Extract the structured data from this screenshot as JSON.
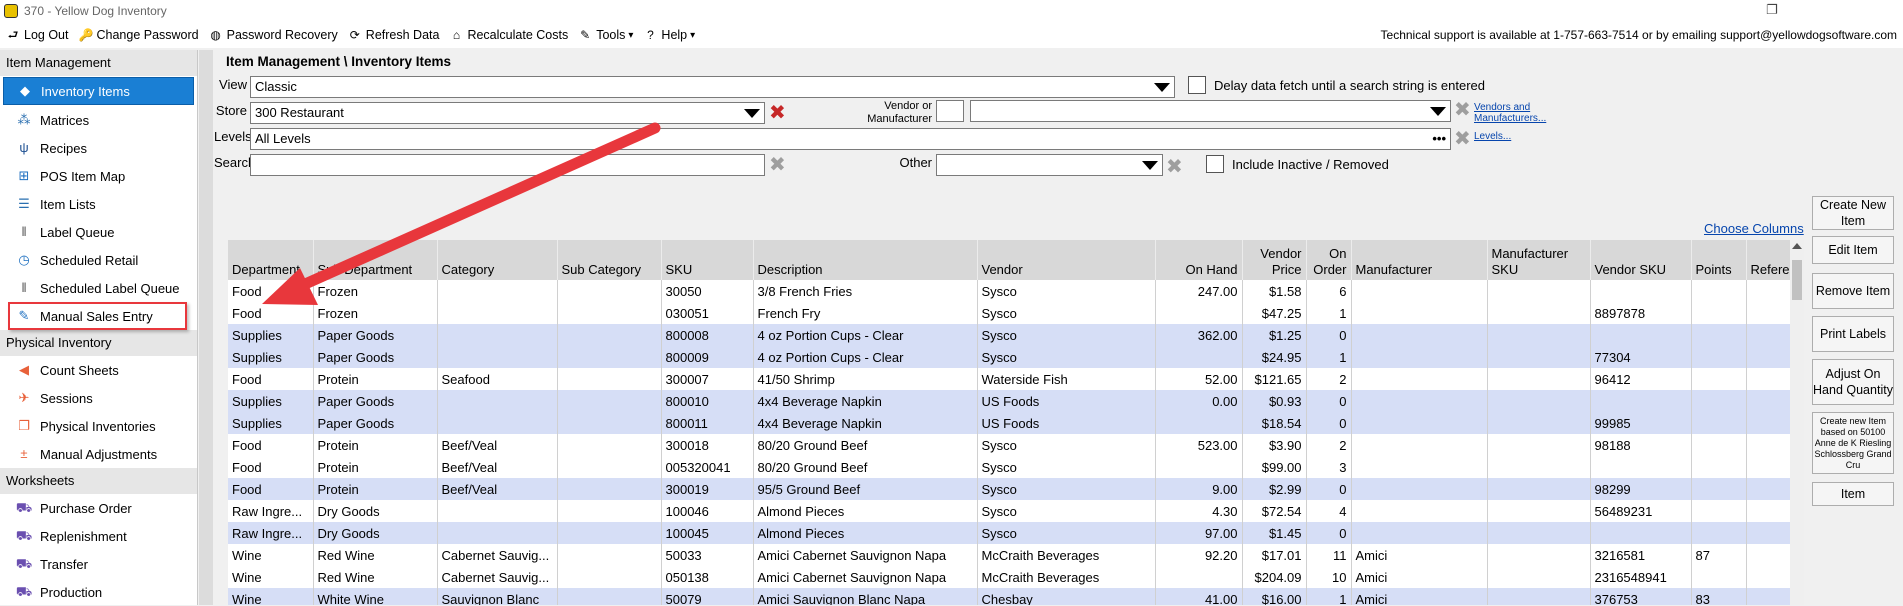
{
  "window": {
    "title": "370 - Yellow Dog Inventory",
    "restore_glyph": "❐",
    "close_glyph": "✕"
  },
  "menubar": {
    "items": [
      {
        "label": "Log Out",
        "icon": "logout-icon",
        "glyph": "⮐"
      },
      {
        "label": "Change Password",
        "icon": "key-icon",
        "glyph": "🔑"
      },
      {
        "label": "Password Recovery",
        "icon": "lifebuoy-icon",
        "glyph": "◍"
      },
      {
        "label": "Refresh Data",
        "icon": "refresh-icon",
        "glyph": "⟳"
      },
      {
        "label": "Recalculate Costs",
        "icon": "bank-icon",
        "glyph": "⌂"
      },
      {
        "label": "Tools",
        "icon": "wrench-icon",
        "glyph": "✎",
        "dropdown": "▾"
      },
      {
        "label": "Help",
        "icon": "help-icon",
        "glyph": "?",
        "dropdown": "▾"
      }
    ],
    "support_text": "Technical support is available at 1-757-663-7514 or by emailing support@yellowdogsoftware.com"
  },
  "sidebar": {
    "sections": [
      {
        "title": "Item Management",
        "items": [
          {
            "label": "Inventory Items",
            "icon": "tag-icon",
            "glyph": "◆",
            "color": "#1a7fd4",
            "active": true
          },
          {
            "label": "Matrices",
            "icon": "matrices-icon",
            "glyph": "⁂",
            "color": "#2a6fb0"
          },
          {
            "label": "Recipes",
            "icon": "utensils-icon",
            "glyph": "ψ",
            "color": "#1d4f91"
          },
          {
            "label": "POS Item Map",
            "icon": "sitemap-icon",
            "glyph": "⊞",
            "color": "#1d6fc0"
          },
          {
            "label": "Item Lists",
            "icon": "list-icon",
            "glyph": "☰",
            "color": "#2a6fb0"
          },
          {
            "label": "Label Queue",
            "icon": "barcode-icon",
            "glyph": "‖",
            "color": "#555555"
          },
          {
            "label": "Scheduled Retail",
            "icon": "clock-icon",
            "glyph": "◷",
            "color": "#1d6fc0"
          },
          {
            "label": "Scheduled Label Queue",
            "icon": "barcode-icon",
            "glyph": "‖",
            "color": "#555555"
          },
          {
            "label": "Manual Sales Entry",
            "icon": "edit-icon",
            "glyph": "✎",
            "color": "#1d6fc0",
            "highlight": true
          }
        ]
      },
      {
        "title": "Physical Inventory",
        "items": [
          {
            "label": "Count Sheets",
            "icon": "send-icon",
            "glyph": "◀",
            "color": "#e8613a"
          },
          {
            "label": "Sessions",
            "icon": "plane-icon",
            "glyph": "✈",
            "color": "#e8613a"
          },
          {
            "label": "Physical Inventories",
            "icon": "documents-icon",
            "glyph": "❐",
            "color": "#e8613a"
          },
          {
            "label": "Manual Adjustments",
            "icon": "plus-minus-icon",
            "glyph": "±",
            "color": "#e8613a"
          }
        ]
      },
      {
        "title": "Worksheets",
        "items": [
          {
            "label": "Purchase Order",
            "icon": "truck-icon",
            "glyph": "⛟",
            "color": "#6a4fb0"
          },
          {
            "label": "Replenishment",
            "icon": "truck-icon",
            "glyph": "⛟",
            "color": "#6a4fb0"
          },
          {
            "label": "Transfer",
            "icon": "truck-icon",
            "glyph": "⛟",
            "color": "#6a4fb0"
          },
          {
            "label": "Production",
            "icon": "truck-icon",
            "glyph": "⛟",
            "color": "#6a4fb0"
          }
        ]
      }
    ]
  },
  "breadcrumb": "Item Management \\ Inventory Items",
  "filters": {
    "view": {
      "label": "View",
      "value": "Classic"
    },
    "delay": {
      "label": "Delay data fetch until a search string is entered"
    },
    "store": {
      "label": "Store",
      "value": "300 Restaurant"
    },
    "vendor": {
      "label_line1": "Vendor or",
      "label_line2": "Manufacturer",
      "code": "",
      "value": "",
      "link_line1": "Vendors and",
      "link_line2": "Manufacturers..."
    },
    "levels": {
      "label": "Levels",
      "value": "All Levels",
      "dots": "•••",
      "link": "Levels..."
    },
    "search": {
      "label": "Search",
      "value": ""
    },
    "other": {
      "label": "Other",
      "value": ""
    },
    "include_inactive": {
      "label": "Include Inactive / Removed"
    },
    "choose_columns": "Choose Columns",
    "clear_glyph": "✖"
  },
  "grid": {
    "columns": [
      {
        "key": "department",
        "label": "Department"
      },
      {
        "key": "sub_department",
        "label": "Sub Department"
      },
      {
        "key": "category",
        "label": "Category"
      },
      {
        "key": "sub_category",
        "label": "Sub Category"
      },
      {
        "key": "sku",
        "label": "SKU"
      },
      {
        "key": "description",
        "label": "Description"
      },
      {
        "key": "vendor",
        "label": "Vendor"
      },
      {
        "key": "on_hand",
        "label": "On Hand",
        "num": true
      },
      {
        "key": "vendor_price",
        "label": "Vendor Price",
        "num": true
      },
      {
        "key": "on_order",
        "label": "On Order",
        "num": true
      },
      {
        "key": "manufacturer",
        "label": "Manufacturer"
      },
      {
        "key": "manufacturer_sku",
        "label": "Manufacturer SKU"
      },
      {
        "key": "vendor_sku",
        "label": "Vendor SKU"
      },
      {
        "key": "points",
        "label": "Points"
      },
      {
        "key": "reference",
        "label": "Reference"
      }
    ],
    "rows": [
      {
        "department": "Food",
        "sub_department": "Frozen",
        "category": "",
        "sub_category": "",
        "sku": "30050",
        "description": "3/8 French Fries",
        "vendor": "Sysco",
        "on_hand": "247.00",
        "vendor_price": "$1.58",
        "on_order": "6",
        "manufacturer": "",
        "manufacturer_sku": "",
        "vendor_sku": "",
        "points": "",
        "reference": "",
        "alt": false
      },
      {
        "department": "Food",
        "sub_department": "Frozen",
        "category": "",
        "sub_category": "",
        "sku": "030051",
        "description": "French Fry",
        "vendor": "Sysco",
        "on_hand": "",
        "vendor_price": "$47.25",
        "on_order": "1",
        "manufacturer": "",
        "manufacturer_sku": "",
        "vendor_sku": "8897878",
        "points": "",
        "reference": "",
        "alt": false
      },
      {
        "department": "Supplies",
        "sub_department": "Paper Goods",
        "category": "",
        "sub_category": "",
        "sku": "800008",
        "description": "4 oz Portion Cups - Clear",
        "vendor": "Sysco",
        "on_hand": "362.00",
        "vendor_price": "$1.25",
        "on_order": "0",
        "manufacturer": "",
        "manufacturer_sku": "",
        "vendor_sku": "",
        "points": "",
        "reference": "",
        "alt": true
      },
      {
        "department": "Supplies",
        "sub_department": "Paper Goods",
        "category": "",
        "sub_category": "",
        "sku": "800009",
        "description": "4 oz Portion Cups - Clear",
        "vendor": "Sysco",
        "on_hand": "",
        "vendor_price": "$24.95",
        "on_order": "1",
        "manufacturer": "",
        "manufacturer_sku": "",
        "vendor_sku": "77304",
        "points": "",
        "reference": "",
        "alt": true
      },
      {
        "department": "Food",
        "sub_department": "Protein",
        "category": "Seafood",
        "sub_category": "",
        "sku": "300007",
        "description": "41/50 Shrimp",
        "vendor": "Waterside Fish",
        "on_hand": "52.00",
        "vendor_price": "$121.65",
        "on_order": "2",
        "manufacturer": "",
        "manufacturer_sku": "",
        "vendor_sku": "96412",
        "points": "",
        "reference": "",
        "alt": false
      },
      {
        "department": "Supplies",
        "sub_department": "Paper Goods",
        "category": "",
        "sub_category": "",
        "sku": "800010",
        "description": "4x4 Beverage Napkin",
        "vendor": "US Foods",
        "on_hand": "0.00",
        "vendor_price": "$0.93",
        "on_order": "0",
        "manufacturer": "",
        "manufacturer_sku": "",
        "vendor_sku": "",
        "points": "",
        "reference": "",
        "alt": true
      },
      {
        "department": "Supplies",
        "sub_department": "Paper Goods",
        "category": "",
        "sub_category": "",
        "sku": "800011",
        "description": "4x4 Beverage Napkin",
        "vendor": "US Foods",
        "on_hand": "",
        "vendor_price": "$18.54",
        "on_order": "0",
        "manufacturer": "",
        "manufacturer_sku": "",
        "vendor_sku": "99985",
        "points": "",
        "reference": "",
        "alt": true
      },
      {
        "department": "Food",
        "sub_department": "Protein",
        "category": "Beef/Veal",
        "sub_category": "",
        "sku": "300018",
        "description": "80/20 Ground Beef",
        "vendor": "Sysco",
        "on_hand": "523.00",
        "vendor_price": "$3.90",
        "on_order": "2",
        "manufacturer": "",
        "manufacturer_sku": "",
        "vendor_sku": "98188",
        "points": "",
        "reference": "",
        "alt": false
      },
      {
        "department": "Food",
        "sub_department": "Protein",
        "category": "Beef/Veal",
        "sub_category": "",
        "sku": "005320041",
        "description": "80/20 Ground Beef",
        "vendor": "Sysco",
        "on_hand": "",
        "vendor_price": "$99.00",
        "on_order": "3",
        "manufacturer": "",
        "manufacturer_sku": "",
        "vendor_sku": "",
        "points": "",
        "reference": "",
        "alt": false
      },
      {
        "department": "Food",
        "sub_department": "Protein",
        "category": "Beef/Veal",
        "sub_category": "",
        "sku": "300019",
        "description": "95/5 Ground Beef",
        "vendor": "Sysco",
        "on_hand": "9.00",
        "vendor_price": "$2.99",
        "on_order": "0",
        "manufacturer": "",
        "manufacturer_sku": "",
        "vendor_sku": "98299",
        "points": "",
        "reference": "",
        "alt": true
      },
      {
        "department": "Raw Ingre...",
        "sub_department": "Dry Goods",
        "category": "",
        "sub_category": "",
        "sku": "100046",
        "description": "Almond Pieces",
        "vendor": "Sysco",
        "on_hand": "4.30",
        "vendor_price": "$72.54",
        "on_order": "4",
        "manufacturer": "",
        "manufacturer_sku": "",
        "vendor_sku": "56489231",
        "points": "",
        "reference": "",
        "alt": false
      },
      {
        "department": "Raw Ingre...",
        "sub_department": "Dry Goods",
        "category": "",
        "sub_category": "",
        "sku": "100045",
        "description": "Almond Pieces",
        "vendor": "Sysco",
        "on_hand": "97.00",
        "vendor_price": "$1.45",
        "on_order": "0",
        "manufacturer": "",
        "manufacturer_sku": "",
        "vendor_sku": "",
        "points": "",
        "reference": "",
        "alt": true
      },
      {
        "department": "Wine",
        "sub_department": "Red Wine",
        "category": "Cabernet Sauvig...",
        "sub_category": "",
        "sku": "50033",
        "description": "Amici Cabernet Sauvignon Napa",
        "vendor": "McCraith Beverages",
        "on_hand": "92.20",
        "vendor_price": "$17.01",
        "on_order": "11",
        "manufacturer": "Amici",
        "manufacturer_sku": "",
        "vendor_sku": "3216581",
        "points": "87",
        "reference": "",
        "alt": false
      },
      {
        "department": "Wine",
        "sub_department": "Red Wine",
        "category": "Cabernet Sauvig...",
        "sub_category": "",
        "sku": "050138",
        "description": "Amici Cabernet Sauvignon Napa",
        "vendor": "McCraith Beverages",
        "on_hand": "",
        "vendor_price": "$204.09",
        "on_order": "10",
        "manufacturer": "Amici",
        "manufacturer_sku": "",
        "vendor_sku": "2316548941",
        "points": "",
        "reference": "",
        "alt": false
      },
      {
        "department": "Wine",
        "sub_department": "White Wine",
        "category": "Sauvignon Blanc",
        "sub_category": "",
        "sku": "50079",
        "description": "Amici Sauvignon Blanc Napa",
        "vendor": "Chesbay",
        "on_hand": "41.00",
        "vendor_price": "$16.00",
        "on_order": "1",
        "manufacturer": "Amici",
        "manufacturer_sku": "",
        "vendor_sku": "376753",
        "points": "83",
        "reference": "",
        "alt": true
      }
    ]
  },
  "actions": [
    {
      "label": "Create New Item",
      "name": "create-new-item-button"
    },
    {
      "label": "Edit Item",
      "name": "edit-item-button"
    },
    {
      "label": "Remove Item",
      "name": "remove-item-button"
    },
    {
      "label": "Print Labels",
      "name": "print-labels-button"
    },
    {
      "label": "Adjust On Hand Quantity",
      "name": "adjust-on-hand-button"
    },
    {
      "label": "Create new Item based on 50100 Anne de K Riesling Schlossberg Grand Cru",
      "name": "create-based-on-button",
      "small": true
    },
    {
      "label": "Item",
      "name": "item-button"
    }
  ],
  "colors": {
    "accent": "#1a7fd4",
    "alt_row": "#d6def6",
    "annotation_red": "#e8373c",
    "clear_red": "#c62828"
  }
}
